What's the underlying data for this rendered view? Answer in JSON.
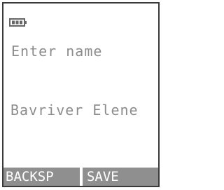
{
  "status_bar": {
    "battery_icon": "battery-icon"
  },
  "form": {
    "prompt": "Enter name",
    "value": "Bavriver Elene"
  },
  "softkeys": {
    "left_label": "BACKSP",
    "right_label": "SAVE"
  },
  "colors": {
    "text": "#8c8c8c",
    "softkey_bg": "#8f8f8f",
    "softkey_text": "#ffffff",
    "background": "#ffffff"
  }
}
